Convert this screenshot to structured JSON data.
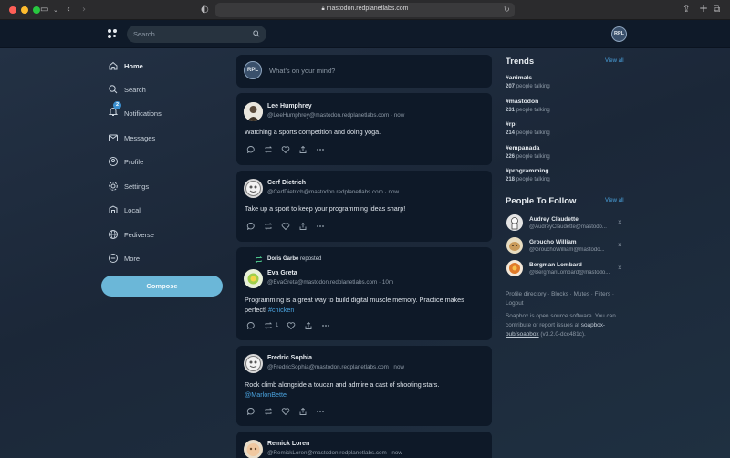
{
  "browser": {
    "url": "mastodon.redplanetlabs.com",
    "lock_icon": "lock-icon"
  },
  "topbar": {
    "search_placeholder": "Search",
    "avatar_initials": "RPL"
  },
  "nav": {
    "items": [
      {
        "label": "Home",
        "icon": "home-icon"
      },
      {
        "label": "Search",
        "icon": "search-icon"
      },
      {
        "label": "Notifications",
        "icon": "bell-icon",
        "badge": "2"
      },
      {
        "label": "Messages",
        "icon": "mail-icon"
      },
      {
        "label": "Profile",
        "icon": "user-icon"
      },
      {
        "label": "Settings",
        "icon": "gear-icon"
      },
      {
        "label": "Local",
        "icon": "local-icon"
      },
      {
        "label": "Fediverse",
        "icon": "globe-icon"
      },
      {
        "label": "More",
        "icon": "more-icon"
      }
    ],
    "compose_label": "Compose"
  },
  "composer": {
    "avatar_initials": "RPL",
    "placeholder": "What's on your mind?"
  },
  "posts": [
    {
      "name": "Lee Humphrey",
      "handle": "@LeeHumphrey@mastodon.redplanetlabs.com · now",
      "text": "Watching a sports competition and doing yoga."
    },
    {
      "name": "Cerf Dietrich",
      "handle": "@CerfDietrich@mastodon.redplanetlabs.com · now",
      "text": "Take up a sport to keep your programming ideas sharp!"
    },
    {
      "reposted_by": "Doris Garbe",
      "reposted_suffix": "reposted",
      "name": "Eva Greta",
      "handle": "@EvaGreta@mastodon.redplanetlabs.com · 10m",
      "text": "Programming is a great way to build digital muscle memory. Practice makes perfect! ",
      "hashtag": "#chicken",
      "repost_count": "1"
    },
    {
      "name": "Fredric Sophia",
      "handle": "@FredricSophia@mastodon.redplanetlabs.com · now",
      "text": "Rock climb alongside a toucan and admire a cast of shooting stars.",
      "mention": "@MarlonBette"
    },
    {
      "name": "Remick Loren",
      "handle": "@RemickLoren@mastodon.redplanetlabs.com · now"
    }
  ],
  "trends": {
    "title": "Trends",
    "view_all": "View all",
    "items": [
      {
        "tag": "#animals",
        "count": "207",
        "suffix": "people talking"
      },
      {
        "tag": "#mastodon",
        "count": "231",
        "suffix": "people talking"
      },
      {
        "tag": "#rpl",
        "count": "214",
        "suffix": "people talking"
      },
      {
        "tag": "#empanada",
        "count": "226",
        "suffix": "people talking"
      },
      {
        "tag": "#programming",
        "count": "218",
        "suffix": "people talking"
      }
    ]
  },
  "follow": {
    "title": "People To Follow",
    "view_all": "View all",
    "items": [
      {
        "name": "Audrey Claudette",
        "handle": "@AudreyClaudette@mastodo..."
      },
      {
        "name": "Groucho William",
        "handle": "@GrouchoWilliam@mastodo..."
      },
      {
        "name": "Bergman Lombard",
        "handle": "@BergmanLombard@mastodo..."
      }
    ],
    "dismiss": "×"
  },
  "footer": {
    "links": "Profile directory · Blocks · Mutes · Filters · Logout",
    "about_prefix": "Soapbox is open source software. You can contribute or report issues at ",
    "about_link": "soapbox-pub/soapbox",
    "about_suffix": " (v3.2.0-dcc481c)."
  },
  "colors": {
    "accent": "#4aa3df",
    "compose": "#6bb7d8",
    "card": "#0e1928",
    "background": "#1a2636"
  }
}
